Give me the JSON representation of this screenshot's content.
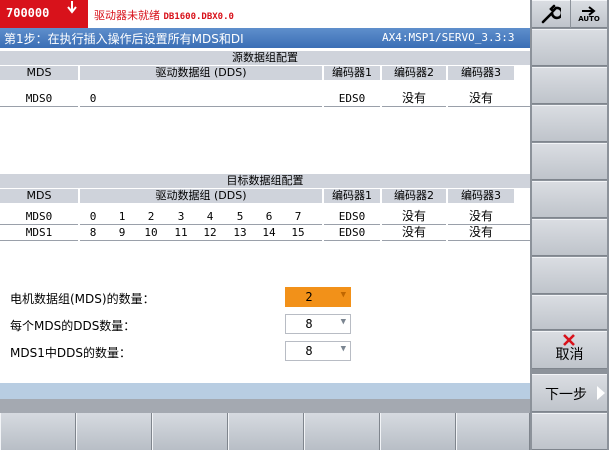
{
  "alarm": {
    "code": "700000",
    "message": "驱动器未就绪",
    "signal": "DB1600.DBX0.0"
  },
  "title": {
    "text": "第1步：在执行插入操作后设置所有MDS和DI",
    "axis": "AX4:MSP1/SERVO_3.3:3"
  },
  "source": {
    "heading": "源数据组配置",
    "headers": {
      "mds": "MDS",
      "dds": "驱动数据组 (DDS)",
      "enc1": "编码器1",
      "enc2": "编码器2",
      "enc3": "编码器3"
    },
    "rows": [
      {
        "mds": "MDS0",
        "dds": [
          "0"
        ],
        "enc1": "EDS0",
        "enc2": "没有",
        "enc3": "没有"
      }
    ]
  },
  "target": {
    "heading": "目标数据组配置",
    "headers": {
      "mds": "MDS",
      "dds": "驱动数据组 (DDS)",
      "enc1": "编码器1",
      "enc2": "编码器2",
      "enc3": "编码器3"
    },
    "rows": [
      {
        "mds": "MDS0",
        "dds": [
          "0",
          "1",
          "2",
          "3",
          "4",
          "5",
          "6",
          "7"
        ],
        "enc1": "EDS0",
        "enc2": "没有",
        "enc3": "没有"
      },
      {
        "mds": "MDS1",
        "dds": [
          "8",
          "9",
          "10",
          "11",
          "12",
          "13",
          "14",
          "15"
        ],
        "enc1": "EDS0",
        "enc2": "没有",
        "enc3": "没有"
      }
    ]
  },
  "settings": [
    {
      "label": "电机数据组(MDS)的数量：",
      "value": "2"
    },
    {
      "label": "每个MDS的DDS数量：",
      "value": "8"
    },
    {
      "label": "MDS1中DDS的数量：",
      "value": "8"
    }
  ],
  "softkeys": {
    "cancel": "取消",
    "next": "下一步",
    "auto": "AUTO"
  },
  "colors": {
    "alarm": "#d8121b",
    "title": "#3a6eb5",
    "active_field": "#f29119"
  }
}
